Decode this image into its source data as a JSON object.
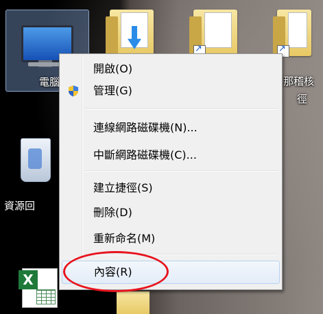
{
  "desktop": {
    "icons": [
      {
        "label": "電腦"
      },
      {
        "label": "資源回"
      },
      {
        "label": "那稽核"
      },
      {
        "label": "徑"
      }
    ]
  },
  "context_menu": {
    "groups": [
      [
        {
          "label": "開啟(O)",
          "icon": null
        },
        {
          "label": "管理(G)",
          "icon": "uac-shield-icon"
        }
      ],
      [
        {
          "label": "連線網路磁碟機(N)..."
        },
        {
          "label": "中斷網路磁碟機(C)..."
        }
      ],
      [
        {
          "label": "建立捷徑(S)"
        },
        {
          "label": "刪除(D)"
        },
        {
          "label": "重新命名(M)"
        }
      ],
      [
        {
          "label": "內容(R)"
        }
      ]
    ]
  },
  "colors": {
    "menu_bg": "#f0f0f0",
    "hover_border": "#b8d2f0",
    "annotation_red": "#e8141e"
  }
}
